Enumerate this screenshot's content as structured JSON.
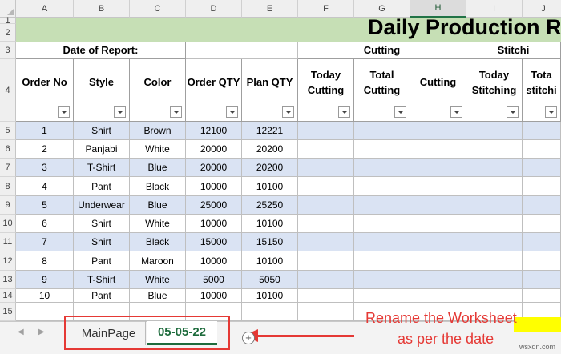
{
  "columns": [
    "A",
    "B",
    "C",
    "D",
    "E",
    "F",
    "G",
    "H",
    "I",
    "J"
  ],
  "selected_column": "H",
  "rows": [
    "1",
    "2",
    "3",
    "4",
    "5",
    "6",
    "7",
    "8",
    "9",
    "10",
    "11",
    "12",
    "13",
    "14",
    "15"
  ],
  "title": "Daily Production R",
  "date_label": "Date of Report:",
  "groups": {
    "cutting": "Cutting",
    "stitching": "Stitchi"
  },
  "headers": [
    "Order No",
    "Style",
    "Color",
    "Order QTY",
    "Plan QTY",
    "Today\nCutting",
    "Total\nCutting",
    "Cutting",
    "Today\nStitching",
    "Tota\nstitchi"
  ],
  "table": [
    [
      "1",
      "Shirt",
      "Brown",
      "12100",
      "12221"
    ],
    [
      "2",
      "Panjabi",
      "White",
      "20000",
      "20200"
    ],
    [
      "3",
      "T-Shirt",
      "Blue",
      "20000",
      "20200"
    ],
    [
      "4",
      "Pant",
      "Black",
      "10000",
      "10100"
    ],
    [
      "5",
      "Underwear",
      "Blue",
      "25000",
      "25250"
    ],
    [
      "6",
      "Shirt",
      "White",
      "10000",
      "10100"
    ],
    [
      "7",
      "Shirt",
      "Black",
      "15000",
      "15150"
    ],
    [
      "8",
      "Pant",
      "Maroon",
      "10000",
      "10100"
    ],
    [
      "9",
      "T-Shirt",
      "White",
      "5000",
      "5050"
    ],
    [
      "10",
      "Pant",
      "Blue",
      "10000",
      "10100"
    ]
  ],
  "tabs": {
    "main": "MainPage",
    "active": "05-05-22",
    "add": "+"
  },
  "nav": {
    "prev": "◀",
    "next": "▶"
  },
  "callout": {
    "line1": "Rename the Worksheet",
    "line2": "as per the date"
  },
  "watermark": "wsxdn.com",
  "colors": {
    "accent": "#1d6b3c",
    "title_band": "#c6dfb5",
    "band_row": "#dae3f3",
    "annotation": "#e53935"
  }
}
